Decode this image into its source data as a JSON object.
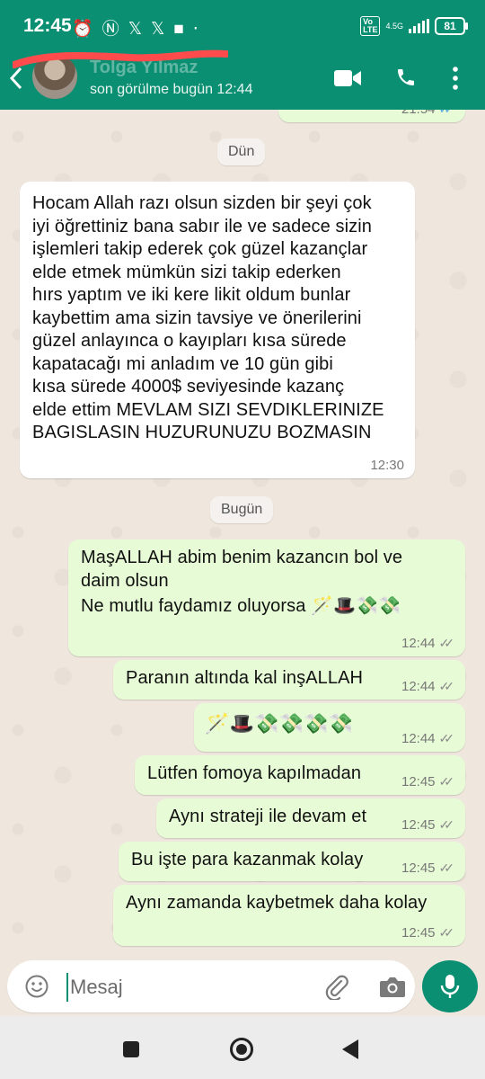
{
  "status_bar": {
    "time": "12:45",
    "network": "4.5G",
    "volte": "VoLTE",
    "battery": "81",
    "icons": [
      "alarm-icon",
      "nfc-icon",
      "x-icon",
      "x-icon",
      "square-icon",
      "more-icon"
    ]
  },
  "header": {
    "contact_name": "Tolga Yılmaz",
    "last_seen": "son görülme bugün 12:44"
  },
  "chat": {
    "top_partial_time": "21:54",
    "date_yesterday": "Dün",
    "date_today": "Bugün",
    "messages": [
      {
        "direction": "in",
        "text": "Hocam Allah razı olsun sizden bir şeyi çok\niyi öğrettiniz bana sabır ile ve sadece sizin\nişlemleri takip ederek çok güzel kazançlar\nelde etmek mümkün sizi takip ederken\nhırs yaptım ve iki kere likit oldum bunlar\nkaybettim ama sizin tavsiye ve önerilerini\ngüzel anlayınca o kayıpları kısa sürede\nkapatacağı mi anladım ve 10 gün gibi\nkısa sürede 4000$ seviyesinde  kazanç\nelde ettim MEVLAM SIZI SEVDIKLERINIZE\nBAGISLASIN HUZURUNUZU BOZMASIN",
        "time": "12:30"
      },
      {
        "direction": "out",
        "text": "MaşALLAH abim benim kazancın bol ve\ndaim olsun",
        "text2": "Ne mutlu faydamız oluyorsa 🪄🎩💸💸",
        "time": "12:44"
      },
      {
        "direction": "out",
        "text": "Paranın altında kal inşALLAH",
        "time": "12:44"
      },
      {
        "direction": "out",
        "text": "🪄🎩💸💸💸💸",
        "time": "12:44"
      },
      {
        "direction": "out",
        "text": "Lütfen fomoya kapılmadan",
        "time": "12:45"
      },
      {
        "direction": "out",
        "text": "Aynı strateji ile devam et",
        "time": "12:45"
      },
      {
        "direction": "out",
        "text": "Bu işte para kazanmak kolay",
        "time": "12:45"
      },
      {
        "direction": "out",
        "text": "Aynı zamanda kaybetmek daha kolay",
        "time": "12:45"
      }
    ]
  },
  "input": {
    "placeholder": "Mesaj"
  },
  "colors": {
    "brand": "#0b8f72",
    "outgoing_bubble": "#e7fcd6",
    "incoming_bubble": "#ffffff",
    "chat_background": "#efe7dd"
  }
}
